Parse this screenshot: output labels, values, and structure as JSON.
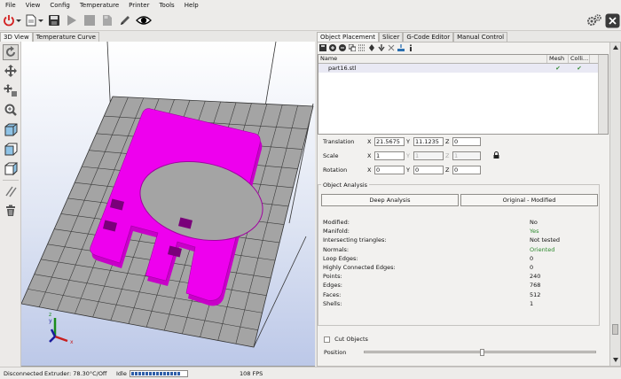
{
  "menu": [
    "File",
    "View",
    "Config",
    "Temperature",
    "Printer",
    "Tools",
    "Help"
  ],
  "view_tabs": [
    "3D View",
    "Temperature Curve"
  ],
  "right_tabs": [
    "Object Placement",
    "Slicer",
    "G-Code Editor",
    "Manual Control"
  ],
  "object_table": {
    "columns": [
      "Name",
      "Mesh",
      "Colli..."
    ],
    "rows": [
      {
        "name": "part16.stl",
        "mesh": "✔",
        "collision": "✔"
      }
    ]
  },
  "transform": {
    "translation": {
      "label": "Translation",
      "x": "21.5675",
      "y": "11.1235",
      "z": "0"
    },
    "scale": {
      "label": "Scale",
      "x": "1",
      "y": "1",
      "z": "1"
    },
    "rotation": {
      "label": "Rotation",
      "x": "0",
      "y": "0",
      "z": "0"
    },
    "axis_x": "X",
    "axis_y": "Y",
    "axis_z": "Z"
  },
  "analysis": {
    "title": "Object Analysis",
    "deep_button": "Deep Analysis",
    "original_button": "Original - Modified",
    "stats": [
      {
        "key": "Modified:",
        "value": "No",
        "ok": false
      },
      {
        "key": "Manifold:",
        "value": "Yes",
        "ok": true
      },
      {
        "key": "Intersecting triangles:",
        "value": "Not tested",
        "ok": false
      },
      {
        "key": "Normals:",
        "value": "Oriented",
        "ok": true
      },
      {
        "key": "Loop Edges:",
        "value": "0",
        "ok": false
      },
      {
        "key": "Highly Connected Edges:",
        "value": "0",
        "ok": false
      },
      {
        "key": "Points:",
        "value": "240",
        "ok": false
      },
      {
        "key": "Edges:",
        "value": "768",
        "ok": false
      },
      {
        "key": "Faces:",
        "value": "512",
        "ok": false
      },
      {
        "key": "Shells:",
        "value": "1",
        "ok": false
      }
    ]
  },
  "cut": {
    "checkbox_label": "Cut Objects",
    "position_label": "Position",
    "position_fraction": 0.5
  },
  "status": {
    "connection": "Disconnected",
    "extruder": "Extruder: 78.30°C/Off",
    "state": "Idle",
    "fps": "108 FPS",
    "progress_fraction": 0.88
  },
  "viewport_axes": {
    "y": "y",
    "z": "z",
    "x": "x"
  },
  "colors": {
    "model": "#ee00ee",
    "bed": "#a4a4a4",
    "ok_green": "#2f8a2f"
  }
}
